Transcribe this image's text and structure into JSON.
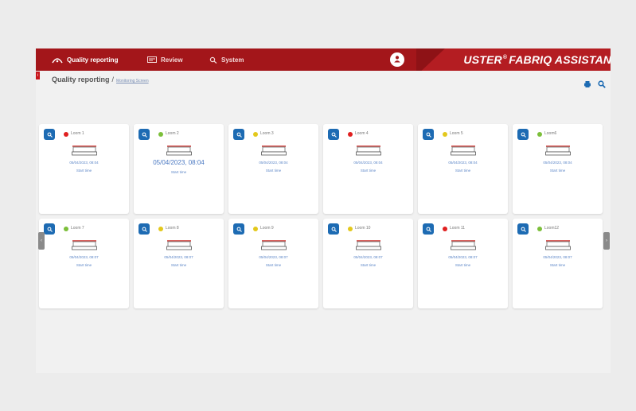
{
  "nav": {
    "items": [
      {
        "label": "Quality reporting",
        "icon": "quality-icon"
      },
      {
        "label": "Review",
        "icon": "review-icon"
      },
      {
        "label": "System",
        "icon": "system-icon"
      }
    ]
  },
  "brand": {
    "name_left": "USTER",
    "mark": "®",
    "name_right": "FABRIQ ASSISTANT"
  },
  "breadcrumb": {
    "title": "Quality reporting",
    "separator": "/",
    "sub": "Monitoring Screen"
  },
  "tick": {
    "label": "i"
  },
  "scroll": {
    "left": "‹",
    "right": "›"
  },
  "colors": {
    "accent": "#1d6bb3",
    "header": "#a3161a",
    "status_red": "#e02020",
    "status_green": "#7cbf3a",
    "status_yellow": "#e3c81c"
  },
  "looms": [
    {
      "name": "Loom 1",
      "status": "red",
      "date": "05/04/2023, 08:04",
      "start_label": "Start time"
    },
    {
      "name": "Loom 2",
      "status": "green",
      "date": "05/04/2023, 08:04",
      "start_label": "Start time"
    },
    {
      "name": "Loom 3",
      "status": "yellow",
      "date": "05/04/2023, 08:04",
      "start_label": "Start time"
    },
    {
      "name": "Loom 4",
      "status": "red",
      "date": "05/04/2023, 08:04",
      "start_label": "Start time"
    },
    {
      "name": "Loom 5",
      "status": "yellow",
      "date": "05/04/2023, 08:04",
      "start_label": "Start time"
    },
    {
      "name": "Loom6",
      "status": "green",
      "date": "05/04/2023, 08:04",
      "start_label": "Start time"
    },
    {
      "name": "Loom 7",
      "status": "green",
      "date": "05/04/2023, 08:07",
      "start_label": "Start time"
    },
    {
      "name": "Loom 8",
      "status": "yellow",
      "date": "05/04/2023, 08:07",
      "start_label": "Start time"
    },
    {
      "name": "Loom 9",
      "status": "yellow",
      "date": "05/04/2023, 08:07",
      "start_label": "Start time"
    },
    {
      "name": "Loom 10",
      "status": "yellow",
      "date": "05/04/2023, 08:07",
      "start_label": "Start time"
    },
    {
      "name": "Loom 11",
      "status": "red",
      "date": "05/04/2023, 08:07",
      "start_label": "Start time"
    },
    {
      "name": "Loom12",
      "status": "green",
      "date": "05/04/2023, 08:07",
      "start_label": "Start time"
    }
  ]
}
